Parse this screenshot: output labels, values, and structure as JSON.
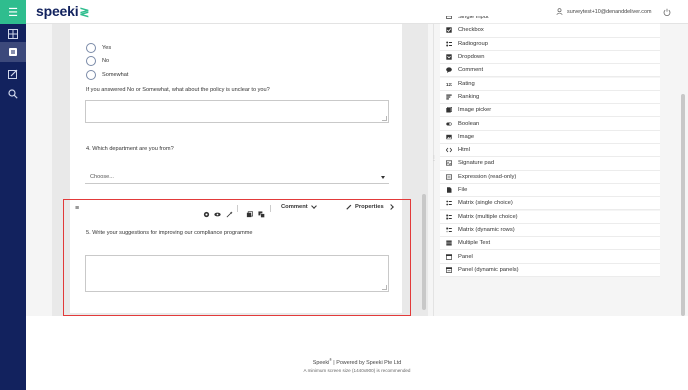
{
  "app": {
    "logo": "speeki",
    "logo_mark": "≷"
  },
  "header": {
    "user_email": "surveytest+10@denanddeliver.com"
  },
  "survey": {
    "q3": {
      "options": [
        "Yes",
        "No",
        "Somewhat"
      ],
      "followup": "If you answered No or Somewhat, what about the policy is unclear to you?"
    },
    "q4": {
      "title": "4.  Which department are you from?",
      "placeholder": "Choose..."
    },
    "q5": {
      "title": "5.  Write your suggestions for improving our compliance programme"
    }
  },
  "selection_toolbar": {
    "question_type": "Comment",
    "properties_label": "Properties",
    "icons": [
      "drag-handle-icon",
      "settings-icon",
      "eye-icon",
      "magic-wand-icon",
      "copy-icon",
      "duplicate-icon"
    ]
  },
  "toolbox": {
    "items": [
      {
        "label": "Single Input",
        "icon": "single-input-icon"
      },
      {
        "label": "Checkbox",
        "icon": "checkbox-icon"
      },
      {
        "label": "Radiogroup",
        "icon": "radiogroup-icon"
      },
      {
        "label": "Dropdown",
        "icon": "dropdown-icon"
      },
      {
        "label": "Comment",
        "icon": "comment-icon"
      },
      {
        "label": "Rating",
        "icon": "rating-icon"
      },
      {
        "label": "Ranking",
        "icon": "ranking-icon"
      },
      {
        "label": "Image picker",
        "icon": "image-picker-icon"
      },
      {
        "label": "Boolean",
        "icon": "boolean-icon"
      },
      {
        "label": "Image",
        "icon": "image-icon"
      },
      {
        "label": "Html",
        "icon": "html-icon"
      },
      {
        "label": "Signature pad",
        "icon": "signature-icon"
      },
      {
        "label": "Expression (read-only)",
        "icon": "expression-icon"
      },
      {
        "label": "File",
        "icon": "file-icon"
      },
      {
        "label": "Matrix (single choice)",
        "icon": "matrix-single-icon"
      },
      {
        "label": "Matrix (multiple choice)",
        "icon": "matrix-multiple-icon"
      },
      {
        "label": "Matrix (dynamic rows)",
        "icon": "matrix-dynamic-icon"
      },
      {
        "label": "Multiple Text",
        "icon": "multiple-text-icon"
      },
      {
        "label": "Panel",
        "icon": "panel-icon"
      },
      {
        "label": "Panel (dynamic panels)",
        "icon": "panel-dynamic-icon"
      }
    ]
  },
  "footer": {
    "brand": "Speeki",
    "registered": "®",
    "powered_by": "Powered by Speeki Pte Ltd",
    "notice": "A minimum screen size (1440x900) is recommended"
  },
  "colors": {
    "nav_bg": "#12225e",
    "accent": "#2fbd8e",
    "selection": "#e23a3a"
  }
}
